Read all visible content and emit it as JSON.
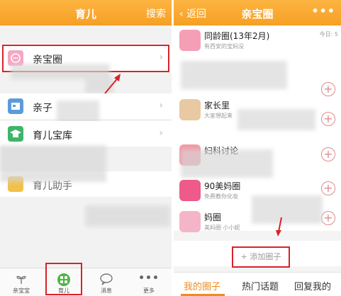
{
  "left": {
    "header": {
      "title": "育儿",
      "search": "搜索"
    },
    "rows": [
      {
        "label": "亲宝圈"
      },
      {
        "label": "亲子"
      },
      {
        "label": "育儿宝库"
      },
      {
        "label": "育儿助手"
      }
    ],
    "tabs": [
      {
        "label": "亲宝宝",
        "icon": "sprout-icon"
      },
      {
        "label": "育儿",
        "icon": "grid-icon"
      },
      {
        "label": "消息",
        "icon": "chat-bubble-icon"
      },
      {
        "label": "更多",
        "icon": "more-dots-icon"
      }
    ]
  },
  "right": {
    "header": {
      "back": "返回",
      "title": "亲宝圈",
      "more": "•••"
    },
    "groups": [
      {
        "name": "同龄圈(13年2月)",
        "sub": "有西安的宝妈没",
        "badge": "今日: 5"
      },
      {
        "name": "家长里",
        "sub": "大家想起来"
      },
      {
        "name": "妇科讨论"
      },
      {
        "name": "90美妈圈",
        "sub": "免费教你化妆"
      },
      {
        "name": "妈圈",
        "sub": "美妈圈 小小妮"
      }
    ],
    "add_group": "添加圈子",
    "bottom_tabs": [
      "我的圈子",
      "热门话题",
      "回复我的"
    ]
  }
}
